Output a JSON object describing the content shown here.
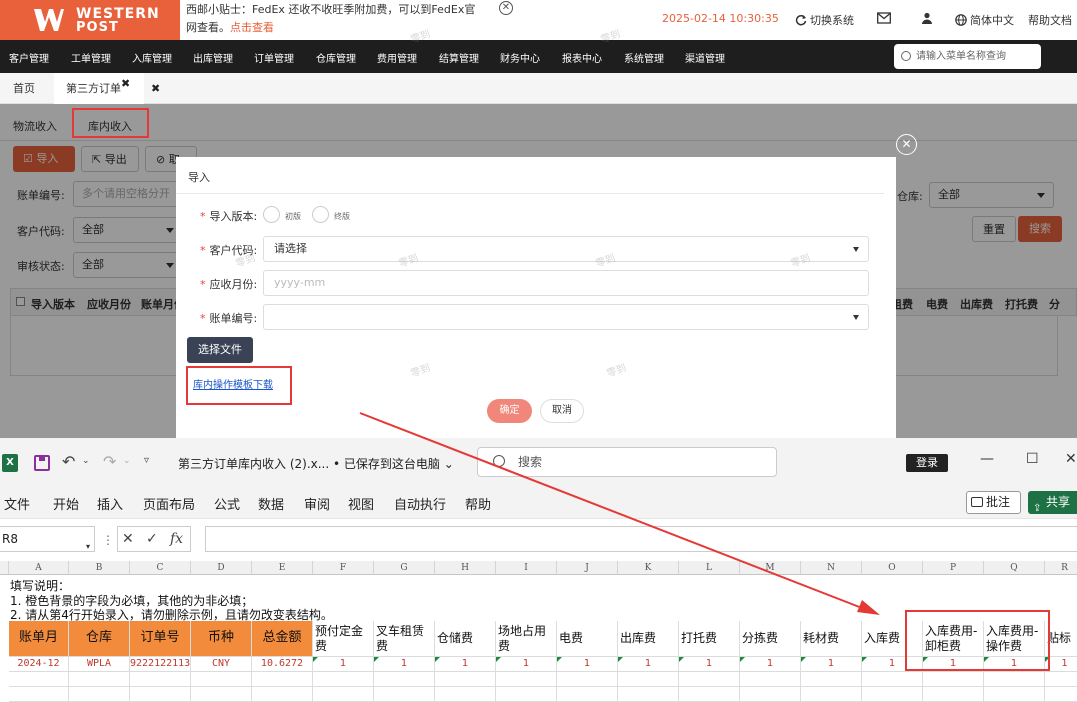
{
  "header": {
    "logo_line1": "WESTERN",
    "logo_line2": "POST",
    "notice_text": "西邮小贴士：FedEx 还收不收旺季附加费，可以到FedEx官网查看。",
    "notice_link": "点击查看",
    "datetime": "2025-02-14 10:30:35",
    "switch_system": "切换系统",
    "language": "简体中文",
    "help": "帮助文档"
  },
  "menu": {
    "items": [
      "客户管理",
      "工单管理",
      "入库管理",
      "出库管理",
      "订单管理",
      "仓库管理",
      "费用管理",
      "结算管理",
      "财务中心",
      "报表中心",
      "系统管理",
      "渠道管理"
    ],
    "search_placeholder": "请输入菜单名称查询"
  },
  "tabs": {
    "home": "首页",
    "current": "第三方订单"
  },
  "page": {
    "subtabs": [
      "物流收入",
      "库内收入"
    ],
    "toolbar": {
      "import": "导入",
      "export": "导出",
      "cancel_short": "取"
    },
    "filters": {
      "bill_no_label": "账单编号:",
      "bill_no_placeholder": "多个请用空格分开",
      "customer_label": "客户代码:",
      "customer_value": "全部",
      "audit_label": "审核状态:",
      "audit_value": "全部",
      "warehouse_label": "仓库:",
      "warehouse_value": "全部",
      "reset": "重置",
      "search": "搜索"
    },
    "table_headers_left": [
      "导入版本",
      "应收月份",
      "账单月份"
    ],
    "table_headers_right": [
      "租费",
      "电费",
      "出库费",
      "打托费",
      "分"
    ]
  },
  "dialog": {
    "title": "导入",
    "version_label": "导入版本:",
    "version_opt1": "初版",
    "version_opt2": "终版",
    "customer_label": "客户代码:",
    "customer_placeholder": "请选择",
    "month_label": "应收月份:",
    "month_placeholder": "yyyy-mm",
    "bill_label": "账单编号:",
    "choose_file": "选择文件",
    "template_link": "库内操作模板下载",
    "ok": "确定",
    "cancel": "取消"
  },
  "watermark": "零到",
  "excel": {
    "filename": "第三方订单库内收入 (2).x... • 已保存到这台电脑",
    "search": "搜索",
    "login": "登录",
    "ribbon_tabs": [
      "文件",
      "开始",
      "插入",
      "页面布局",
      "公式",
      "数据",
      "审阅",
      "视图",
      "自动执行",
      "帮助"
    ],
    "comment": "批注",
    "share": "共享",
    "name_box": "R8",
    "fx": "fx",
    "columns": [
      "A",
      "B",
      "C",
      "D",
      "E",
      "F",
      "G",
      "H",
      "I",
      "J",
      "K",
      "L",
      "M",
      "N",
      "O",
      "P",
      "Q",
      "R"
    ],
    "notes": [
      "填写说明：",
      "1. 橙色背景的字段为必填，其他的为非必填；",
      "2. 请从第4行开始录入，请勿删除示例，且请勿改变表结构。"
    ],
    "headers": [
      "账单月",
      "仓库",
      "订单号",
      "币种",
      "总金额",
      "预付定金费",
      "叉车租赁费",
      "仓储费",
      "场地占用费",
      "电费",
      "出库费",
      "打托费",
      "分拣费",
      "耗材费",
      "入库费",
      "入库费用-卸柜费",
      "入库费用-操作费",
      "贴标费"
    ],
    "row": [
      "2024-12",
      "WPLA",
      "9222122113",
      "CNY",
      "10.6272",
      "1",
      "1",
      "1",
      "1",
      "1",
      "1",
      "1",
      "1",
      "1",
      "1",
      "1",
      "1",
      "1"
    ]
  },
  "colors": {
    "accent": "#e8613b",
    "annotation": "#e53935",
    "excel_green": "#1e7145",
    "required_header": "#f28c3c"
  }
}
